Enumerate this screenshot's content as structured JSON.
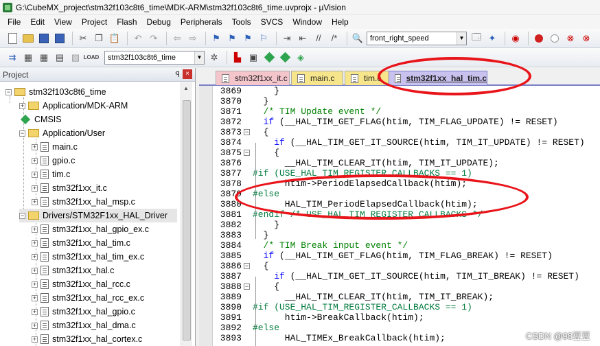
{
  "window": {
    "title": "G:\\CubeMX_project\\stm32f103c8t6_time\\MDK-ARM\\stm32f103c8t6_time.uvprojx - µVision"
  },
  "menu": [
    "File",
    "Edit",
    "View",
    "Project",
    "Flash",
    "Debug",
    "Peripherals",
    "Tools",
    "SVCS",
    "Window",
    "Help"
  ],
  "toolbar": {
    "find_combo": "front_right_speed",
    "target_combo": "stm32f103c8t6_time"
  },
  "project_panel": {
    "title": "Project",
    "pin": "ꟼ",
    "close": "×",
    "root": "stm32f103c8t6_time",
    "groups": [
      {
        "name": "Application/MDK-ARM"
      },
      {
        "name": "CMSIS"
      },
      {
        "name": "Application/User",
        "files": [
          "main.c",
          "gpio.c",
          "tim.c",
          "stm32f1xx_it.c",
          "stm32f1xx_hal_msp.c"
        ]
      },
      {
        "name": "Drivers/STM32F1xx_HAL_Driver",
        "files": [
          "stm32f1xx_hal_gpio_ex.c",
          "stm32f1xx_hal_tim.c",
          "stm32f1xx_hal_tim_ex.c",
          "stm32f1xx_hal.c",
          "stm32f1xx_hal_rcc.c",
          "stm32f1xx_hal_rcc_ex.c",
          "stm32f1xx_hal_gpio.c",
          "stm32f1xx_hal_dma.c",
          "stm32f1xx_hal_cortex.c"
        ]
      }
    ]
  },
  "tabs": [
    {
      "label": "stm32f1xx_it.c",
      "color": "#f4c6cc",
      "active": false
    },
    {
      "label": "main.c",
      "color": "#f6e58a",
      "active": false
    },
    {
      "label": "tim.c",
      "color": "#f6e58a",
      "active": false
    },
    {
      "label": "stm32f1xx_hal_tim.c",
      "color": "#c9c1ee",
      "active": true
    }
  ],
  "code": {
    "lines": [
      {
        "num": "3869",
        "fold": "",
        "text": "    }",
        "cls": "tx"
      },
      {
        "num": "3870",
        "fold": "",
        "text": "  }",
        "cls": "tx"
      },
      {
        "num": "3871",
        "fold": "",
        "text": "  /* TIM Update event */",
        "cls": "cm"
      },
      {
        "num": "3872",
        "fold": "",
        "text": "  if (__HAL_TIM_GET_FLAG(htim, TIM_FLAG_UPDATE) != RESET)",
        "cls": "kw-if"
      },
      {
        "num": "3873",
        "fold": "−",
        "text": "  {",
        "cls": "tx"
      },
      {
        "num": "3874",
        "fold": "",
        "text": "    if (__HAL_TIM_GET_IT_SOURCE(htim, TIM_IT_UPDATE) != RESET)",
        "cls": "kw-if"
      },
      {
        "num": "3875",
        "fold": "−",
        "text": "    {",
        "cls": "tx"
      },
      {
        "num": "3876",
        "fold": "",
        "text": "      __HAL_TIM_CLEAR_IT(htim, TIM_IT_UPDATE);",
        "cls": "tx"
      },
      {
        "num": "3877",
        "fold": "",
        "text": "#if (USE_HAL_TIM_REGISTER_CALLBACKS == 1)",
        "cls": "pp"
      },
      {
        "num": "3878",
        "fold": "",
        "text": "      htim->PeriodElapsedCallback(htim);",
        "cls": "tx"
      },
      {
        "num": "3879",
        "fold": "",
        "text": "#else",
        "cls": "pp"
      },
      {
        "num": "3880",
        "fold": "",
        "text": "      HAL_TIM_PeriodElapsedCallback(htim);",
        "cls": "tx"
      },
      {
        "num": "3881",
        "fold": "",
        "text": "#endif /* USE_HAL_TIM_REGISTER_CALLBACKS */",
        "cls": "pp"
      },
      {
        "num": "3882",
        "fold": "",
        "text": "    }",
        "cls": "tx"
      },
      {
        "num": "3883",
        "fold": "",
        "text": "  }",
        "cls": "tx"
      },
      {
        "num": "3884",
        "fold": "",
        "text": "  /* TIM Break input event */",
        "cls": "cm"
      },
      {
        "num": "3885",
        "fold": "",
        "text": "  if (__HAL_TIM_GET_FLAG(htim, TIM_FLAG_BREAK) != RESET)",
        "cls": "kw-if"
      },
      {
        "num": "3886",
        "fold": "−",
        "text": "  {",
        "cls": "tx"
      },
      {
        "num": "3887",
        "fold": "",
        "text": "    if (__HAL_TIM_GET_IT_SOURCE(htim, TIM_IT_BREAK) != RESET)",
        "cls": "kw-if"
      },
      {
        "num": "3888",
        "fold": "−",
        "text": "    {",
        "cls": "tx"
      },
      {
        "num": "3889",
        "fold": "",
        "text": "      __HAL_TIM_CLEAR_IT(htim, TIM_IT_BREAK);",
        "cls": "tx"
      },
      {
        "num": "3890",
        "fold": "",
        "text": "#if (USE_HAL_TIM_REGISTER_CALLBACKS == 1)",
        "cls": "pp"
      },
      {
        "num": "3891",
        "fold": "",
        "text": "      htim->BreakCallback(htim);",
        "cls": "tx"
      },
      {
        "num": "3892",
        "fold": "",
        "text": "#else",
        "cls": "pp"
      },
      {
        "num": "3893",
        "fold": "",
        "text": "      HAL_TIMEx_BreakCallback(htim);",
        "cls": "tx"
      }
    ]
  },
  "watermark": "CSDN @98豆豆"
}
